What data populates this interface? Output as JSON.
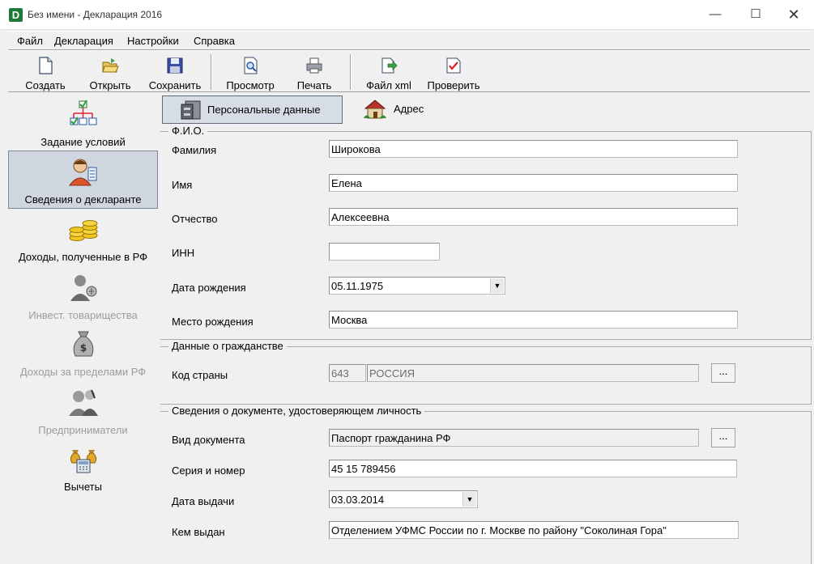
{
  "window": {
    "title": "Без имени - Декларация 2016",
    "app_icon_letter": "D",
    "controls": {
      "minimize": "—",
      "maximize": "☐",
      "close": "✕"
    }
  },
  "menu": [
    "Файл",
    "Декларация",
    "Настройки",
    "Справка"
  ],
  "toolbar": {
    "create": "Создать",
    "open": "Открыть",
    "save": "Сохранить",
    "preview": "Просмотр",
    "print": "Печать",
    "xml": "Файл xml",
    "check": "Проверить"
  },
  "sidebar": [
    {
      "label": "Задание условий",
      "icon": "tree-structure-icon",
      "state": "normal"
    },
    {
      "label": "Сведения о декларанте",
      "icon": "person-icon",
      "state": "active"
    },
    {
      "label": "Доходы, полученные в РФ",
      "icon": "coins-icon",
      "state": "normal"
    },
    {
      "label": "Инвест. товарищества",
      "icon": "investor-icon",
      "state": "disabled"
    },
    {
      "label": "Доходы за пределами РФ",
      "icon": "money-bag-icon",
      "state": "disabled"
    },
    {
      "label": "Предприниматели",
      "icon": "entrepreneur-icon",
      "state": "disabled"
    },
    {
      "label": "Вычеты",
      "icon": "deductions-icon",
      "state": "normal"
    }
  ],
  "tabs": {
    "personal": "Персональные данные",
    "address": "Адрес"
  },
  "fio": {
    "title": "Ф.И.О.",
    "surname_label": "Фамилия",
    "surname": "Широкова",
    "name_label": "Имя",
    "name": "Елена",
    "patronymic_label": "Отчество",
    "patronymic": "Алексеевна",
    "inn_label": "ИНН",
    "inn": "",
    "birthdate_label": "Дата рождения",
    "birthdate": "05.11.1975",
    "birthplace_label": "Место рождения",
    "birthplace": "Москва"
  },
  "citizenship": {
    "title": "Данные о гражданстве",
    "country_code_label": "Код страны",
    "country_code": "643",
    "country_name": "РОССИЯ",
    "browse": "..."
  },
  "document": {
    "title": "Сведения о документе, удостоверяющем личность",
    "type_label": "Вид документа",
    "type": "Паспорт гражданина РФ",
    "browse": "...",
    "series_label": "Серия и номер",
    "series": "45 15 789456",
    "issue_date_label": "Дата выдачи",
    "issue_date": "03.03.2014",
    "issued_by_label": "Кем выдан",
    "issued_by": "Отделением УФМС России по г. Москве по району \"Соколиная Гора\""
  },
  "colors": {
    "accent_green": "#1f7a3a",
    "active_nav_bg": "#cfd6df",
    "window_bg": "#f0f0f0"
  }
}
